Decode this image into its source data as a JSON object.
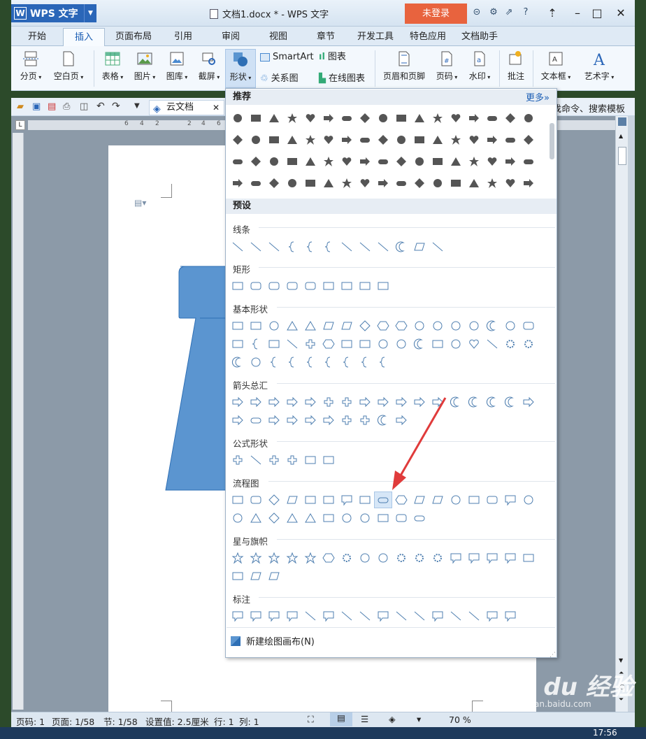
{
  "app": {
    "logo_text": "WPS 文字",
    "doc_title": "文档1.docx * - WPS 文字",
    "login": "未登录"
  },
  "tabs": [
    "开始",
    "插入",
    "页面布局",
    "引用",
    "审阅",
    "视图",
    "章节",
    "开发工具",
    "特色应用",
    "文档助手"
  ],
  "active_tab": "插入",
  "ribbon": {
    "page_break": "分页",
    "blank_page": "空白页",
    "table": "表格",
    "picture": "图片",
    "gallery": "图库",
    "screenshot": "截屏",
    "shapes": "形状",
    "smartart": "SmartArt",
    "chart": "图表",
    "relation": "关系图",
    "online_chart": "在线图表",
    "header_footer": "页眉和页脚",
    "page_num": "页码",
    "watermark": "水印",
    "comment": "批注",
    "textbox": "文本框",
    "wordart": "艺术字"
  },
  "quickbar": {
    "cloud_doc": "云文档",
    "right_text": "找命令、搜索模板"
  },
  "dropdown": {
    "recommended": "推荐",
    "more": "更多»",
    "presets": "预设",
    "categories": {
      "lines": "线条",
      "rect": "矩形",
      "basic": "基本形状",
      "arrows": "箭头总汇",
      "equation": "公式形状",
      "flowchart": "流程图",
      "stars": "星与旗帜",
      "callouts": "标注"
    },
    "new_canvas": "新建绘图画布(N)"
  },
  "ruler_numbers": [
    "6",
    "4",
    "2",
    "2",
    "4",
    "6"
  ],
  "status": {
    "page_code": "页码: 1",
    "page": "页面: 1/58",
    "section": "节: 1/58",
    "setting": "设置值: 2.5厘米",
    "row": "行: 1",
    "col": "列: 1",
    "zoom": "70 %"
  },
  "taskbar": {
    "time": "17:56"
  },
  "watermark": {
    "main": "Bai du 经验",
    "sub": "jingyan.baidu.com"
  },
  "colors": {
    "accent": "#2a66b8",
    "login_bg": "#e8633e",
    "shape_fill": "#5b95d0",
    "shape_stroke": "#2e6fb5",
    "arrow": "#e03b3b"
  }
}
